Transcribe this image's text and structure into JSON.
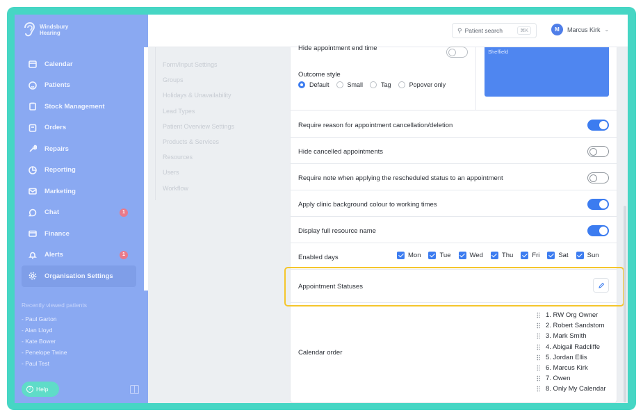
{
  "brand": {
    "name_line1": "Windsbury",
    "name_line2": "Hearing"
  },
  "sidebar": {
    "items": [
      {
        "label": "Calendar",
        "icon": "calendar-icon"
      },
      {
        "label": "Patients",
        "icon": "smile-icon"
      },
      {
        "label": "Stock Management",
        "icon": "box-icon"
      },
      {
        "label": "Orders",
        "icon": "orders-icon"
      },
      {
        "label": "Repairs",
        "icon": "wrench-icon"
      },
      {
        "label": "Reporting",
        "icon": "pie-chart-icon"
      },
      {
        "label": "Marketing",
        "icon": "mail-icon"
      },
      {
        "label": "Chat",
        "icon": "chat-icon",
        "badge": "1"
      },
      {
        "label": "Finance",
        "icon": "card-icon"
      },
      {
        "label": "Alerts",
        "icon": "bell-icon",
        "badge": "1"
      },
      {
        "label": "Organisation Settings",
        "icon": "gear-icon",
        "active": true
      }
    ],
    "recent_title": "Recently viewed patients",
    "recent": [
      "- Paul Garton",
      "- Alan Lloyd",
      "- Kate Bower",
      "- Penelope Twine",
      "- Paul Test"
    ],
    "help_label": "Help"
  },
  "header": {
    "search_label": "Patient search",
    "search_shortcut": "⌘K",
    "user_initial": "M",
    "user_name": "Marcus Kirk"
  },
  "settings_nav": [
    "Form/Input Settings",
    "Groups",
    "Holidays & Unavailability",
    "Lead Types",
    "Patient Overview Settings",
    "Products & Services",
    "Resources",
    "Users",
    "Workflow"
  ],
  "settings": {
    "hide_end_time_label": "Hide appointment end time",
    "panel_text": "Sheffield",
    "outcome_style": {
      "label": "Outcome style",
      "options": [
        "Default",
        "Small",
        "Tag",
        "Popover only"
      ],
      "selected": "Default"
    },
    "toggles": [
      {
        "label": "Require reason for appointment cancellation/deletion",
        "on": true
      },
      {
        "label": "Hide cancelled appointments",
        "on": false
      },
      {
        "label": "Require note when applying the rescheduled status to an appointment",
        "on": false
      },
      {
        "label": "Apply clinic background colour to working times",
        "on": true
      },
      {
        "label": "Display full resource name",
        "on": true
      }
    ],
    "enabled_days": {
      "label": "Enabled days",
      "days": [
        "Mon",
        "Tue",
        "Wed",
        "Thu",
        "Fri",
        "Sat",
        "Sun"
      ]
    },
    "appointment_statuses_label": "Appointment Statuses",
    "calendar_order": {
      "label": "Calendar order",
      "items": [
        "1. RW Org Owner",
        "2. Robert Sandstom",
        "3. Mark Smith",
        "4. Abigail Radcliffe",
        "5. Jordan Ellis",
        "6. Marcus Kirk",
        "7. Owen",
        "8. Only My Calendar"
      ]
    }
  },
  "colors": {
    "accent": "#3c7cf0",
    "highlight": "#f4c62c",
    "frame": "#46d6c4",
    "sidebar": "#8aa9f2"
  }
}
